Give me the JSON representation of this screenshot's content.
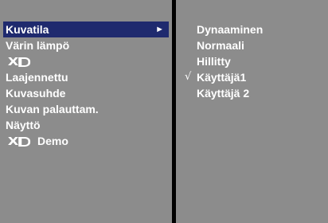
{
  "colors": {
    "panel_bg": "#8c8c8c",
    "background": "#000000",
    "highlight": "#1f2a6e",
    "text": "#ffffff"
  },
  "menu": {
    "items": [
      {
        "label": "Kuvatila",
        "has_submenu": true,
        "arrow": "►"
      },
      {
        "label": "Värin lämpö"
      },
      {
        "label": "XD",
        "logo": true
      },
      {
        "label": "Laajennettu"
      },
      {
        "label": "Kuvasuhde"
      },
      {
        "label": "Kuvan palauttam."
      },
      {
        "label": "Näyttö"
      },
      {
        "label": "Demo",
        "logo_prefix": "XD"
      }
    ]
  },
  "submenu": {
    "items": [
      {
        "label": "Dynaaminen"
      },
      {
        "label": "Normaali"
      },
      {
        "label": "Hillitty"
      },
      {
        "label": "Käyttäjä1",
        "checked": true,
        "check_mark": "√"
      },
      {
        "label": "Käyttäjä 2"
      }
    ]
  }
}
